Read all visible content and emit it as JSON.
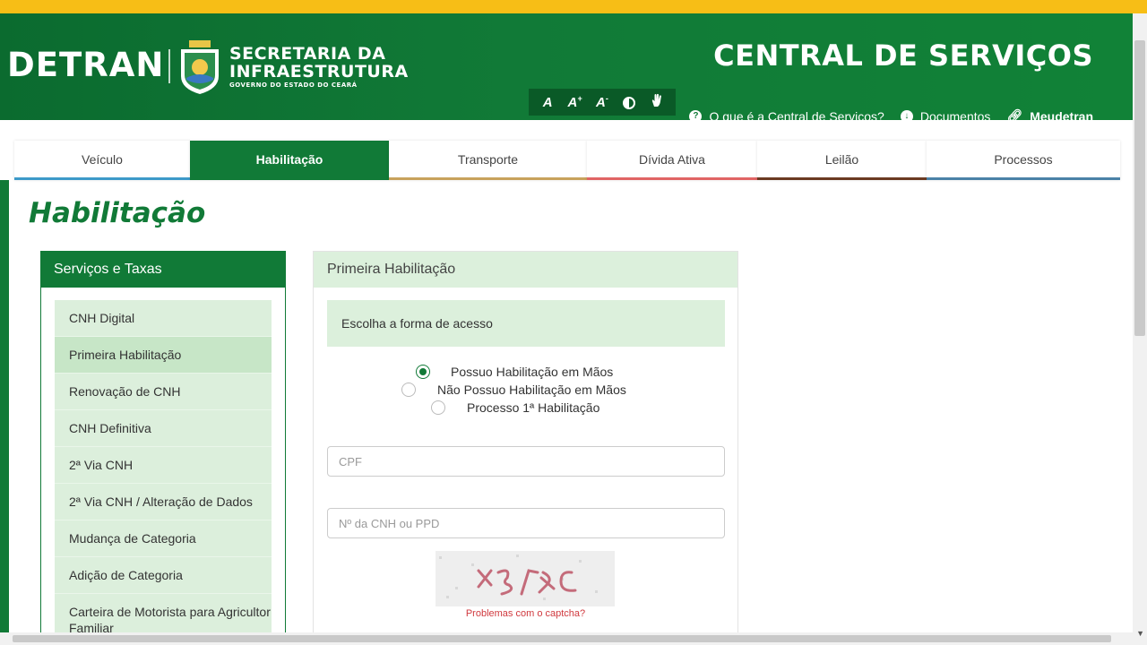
{
  "header": {
    "logo_text": "DETRAN",
    "secretaria_line1": "SECRETARIA DA",
    "secretaria_line2": "INFRAESTRUTURA",
    "secretaria_sub": "GOVERNO DO ESTADO DO CEARÁ",
    "central_title": "CENTRAL DE SERVIÇOS",
    "accessibility": {
      "font_normal": "A",
      "font_increase": "A",
      "font_decrease": "A"
    },
    "links": {
      "about": "O que é a Central de Serviços?",
      "documents": "Documentos",
      "meudetran": "Meudetran"
    }
  },
  "tabs": [
    {
      "label": "Veículo",
      "color": "#3d9ac9"
    },
    {
      "label": "Habilitação",
      "color": "#117a37"
    },
    {
      "label": "Transporte",
      "color": "#c8a25c"
    },
    {
      "label": "Dívida Ativa",
      "color": "#e06464"
    },
    {
      "label": "Leilão",
      "color": "#6b3a22"
    },
    {
      "label": "Processos",
      "color": "#4a82a7"
    }
  ],
  "page_title": "Habilitação",
  "sidebar": {
    "title": "Serviços e Taxas",
    "items": [
      {
        "label": "CNH Digital"
      },
      {
        "label": "Primeira Habilitação"
      },
      {
        "label": "Renovação de CNH"
      },
      {
        "label": "CNH Definitiva"
      },
      {
        "label": "2ª Via CNH"
      },
      {
        "label": "2ª Via CNH / Alteração de Dados"
      },
      {
        "label": "Mudança de Categoria"
      },
      {
        "label": "Adição de Categoria"
      },
      {
        "label": "Carteira de Motorista para Agricultor Familiar"
      }
    ]
  },
  "panel": {
    "title": "Primeira Habilitação",
    "choose_label": "Escolha a forma de acesso",
    "options": [
      {
        "label": "Possuo Habilitação em Mãos",
        "selected": true
      },
      {
        "label": "Não Possuo Habilitação em Mãos",
        "selected": false
      },
      {
        "label": "Processo 1ª Habilitação",
        "selected": false
      }
    ],
    "cpf_placeholder": "CPF",
    "cnh_placeholder": "Nº da CNH ou PPD",
    "captcha_help": "Problemas com o captcha?"
  },
  "colors": {
    "brand_green": "#117a37",
    "light_green": "#dcf0dc",
    "topbar_yellow": "#f7be16"
  }
}
